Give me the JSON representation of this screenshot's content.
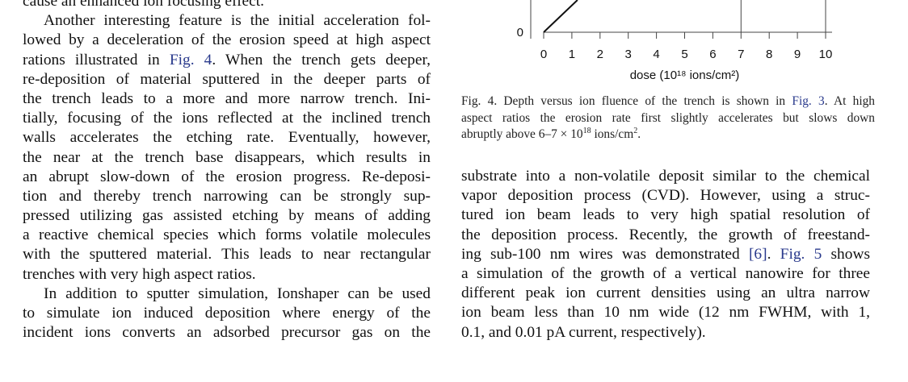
{
  "left_column": {
    "lines": [
      {
        "text": "cause an enhanced ion focusing effect.",
        "last": true,
        "indent": false
      },
      {
        "pre": "Another interesting feature is the initial acceleration fol-",
        "indent": true
      },
      {
        "pre": "lowed by a deceleration of the erosion speed at high aspect"
      },
      {
        "pre": "rations illustrated in ",
        "link": "Fig. 4",
        "post": ". When the trench gets deeper,"
      },
      {
        "pre": "re-deposition of material sputtered in the deeper parts of"
      },
      {
        "pre": "the trench leads to a more and more narrow trench. Ini-"
      },
      {
        "pre": "tially, focusing of the ions reflected at the inclined trench"
      },
      {
        "pre": "walls accelerates the etching rate. Eventually, however,"
      },
      {
        "pre": "the near at the trench base disappears, which results in"
      },
      {
        "pre": "an abrupt slow-down of the erosion progress. Re-deposi-"
      },
      {
        "pre": "tion and thereby trench narrowing can be strongly sup-"
      },
      {
        "pre": "pressed utilizing gas assisted etching by means of adding"
      },
      {
        "pre": "a reactive chemical species which forms volatile molecules"
      },
      {
        "pre": "with the sputtered material. This leads to near rectangular"
      },
      {
        "pre": "trenches with very high aspect ratios.",
        "last": true
      },
      {
        "pre": "In addition to sputter simulation, Ionshaper can be used",
        "indent": true
      },
      {
        "pre": "to simulate ion induced deposition where energy of the"
      },
      {
        "pre": "incident ions converts an adsorbed precursor gas on the"
      }
    ]
  },
  "right_column": {
    "lines": [
      {
        "pre": "substrate into a non-volatile deposit similar to the chemical"
      },
      {
        "pre": "vapor deposition process (CVD). However, using a struc-"
      },
      {
        "pre": "tured ion beam leads to very high spatial resolution of"
      },
      {
        "pre": "the deposition process. Recently, the growth of freestand-"
      },
      {
        "pre": "ing sub-100 nm wires was demonstrated ",
        "link": "[6]",
        "mid": ". ",
        "link2": "Fig. 5",
        "post": " shows"
      },
      {
        "pre": "a simulation of the growth of a vertical nanowire for three"
      },
      {
        "pre": "different peak ion current densities using an ultra narrow"
      },
      {
        "pre": "ion beam less than 10 nm wide (12 nm FWHM, with 1,"
      },
      {
        "pre": "0.1, and 0.01 pA current, respectively).",
        "last": true
      }
    ]
  },
  "caption": {
    "line1_pre": "Fig. 4.  Depth versus ion fluence of the trench is shown in ",
    "line1_link": "Fig. 3",
    "line1_post": ". At high",
    "line2": "aspect ratios the erosion rate first slightly accelerates but slows down",
    "line3_pre": "abruptly above 6–7 × 10",
    "line3_sup": "18",
    "line3_mid": " ions/cm",
    "line3_sup2": "2",
    "line3_post": "."
  },
  "chart_data": {
    "type": "line",
    "xlabel": "dose (10¹⁸ ions/cm²)",
    "x_ticks": [
      "0",
      "1",
      "2",
      "3",
      "4",
      "5",
      "6",
      "7",
      "8",
      "9",
      "10"
    ],
    "y_ticks": [
      "0"
    ],
    "xlim": [
      0,
      10
    ],
    "series": [
      {
        "x": [
          0,
          0.6,
          1.2
        ],
        "y": [
          0,
          0.25,
          0.5
        ]
      }
    ],
    "vertical_lines_x": [
      7,
      10
    ],
    "colors": {
      "line": "#111111",
      "axis": "#444444"
    }
  }
}
